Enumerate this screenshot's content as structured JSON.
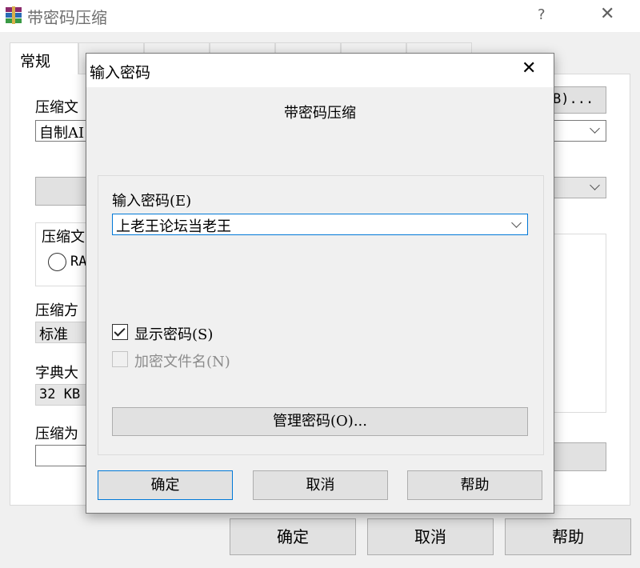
{
  "window": {
    "title": "带密码压缩",
    "help_label": "?",
    "close_label": "✕"
  },
  "tabs": [
    {
      "label": "常规",
      "active": true
    }
  ],
  "general": {
    "archive_name_label": "压缩文",
    "archive_name_value": "自制AI",
    "browse_label": "B)...",
    "archive_format_label": "压缩文",
    "archive_format_option": "RA",
    "method_label": "压缩方",
    "method_value": "标准",
    "dictionary_label": "字典大",
    "dictionary_value": "32 KB",
    "split_label": "压缩为"
  },
  "main_buttons": {
    "ok": "确定",
    "cancel": "取消",
    "help": "帮助"
  },
  "dialog": {
    "title": "输入密码",
    "close_label": "✕",
    "caption": "带密码压缩",
    "password_label": "输入密码(E)",
    "password_value": "上老王论坛当老王",
    "show_password_label": "显示密码(S)",
    "show_password_checked": true,
    "encrypt_names_label": "加密文件名(N)",
    "encrypt_names_enabled": false,
    "manage_label": "管理密码(O)...",
    "ok": "确定",
    "cancel": "取消",
    "help": "帮助"
  },
  "colors": {
    "accent": "#0078d7",
    "window_bg": "#f0f0f0",
    "button_bg": "#e1e1e1",
    "disabled_text": "#8c8c8c"
  }
}
